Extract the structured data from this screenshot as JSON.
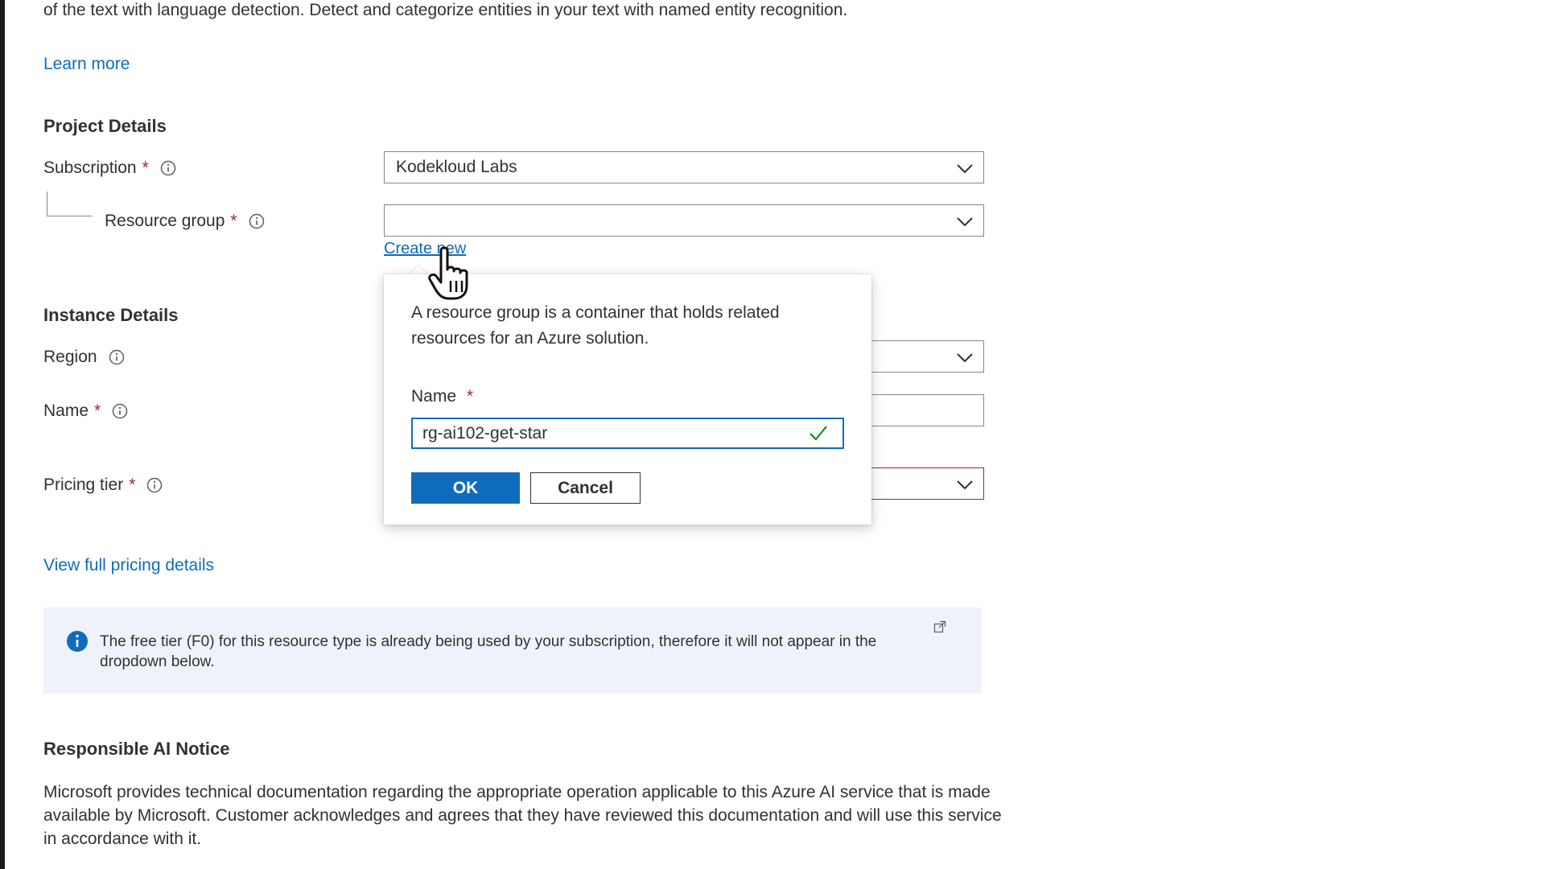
{
  "intro_text": "of the text with language detection. Detect and categorize entities in your text with named entity recognition.",
  "learn_more": "Learn more",
  "project_details": {
    "title": "Project Details",
    "subscription_label": "Subscription",
    "subscription_value": "Kodekloud Labs",
    "resource_group_label": "Resource group",
    "resource_group_value": "",
    "create_new": "Create new",
    "required_mark": "*"
  },
  "instance_details": {
    "title": "Instance Details",
    "region_label": "Region",
    "name_label": "Name",
    "pricing_tier_label": "Pricing tier"
  },
  "view_pricing": "View full pricing details",
  "popup": {
    "description": "A resource group is a container that holds related resources for an Azure solution.",
    "name_label": "Name",
    "name_value": "rg-ai102-get-star",
    "ok_label": "OK",
    "cancel_label": "Cancel"
  },
  "notice": {
    "text": "The free tier (F0) for this resource type is already being used by your subscription, therefore it will not appear in the dropdown below."
  },
  "responsible_ai": {
    "title": "Responsible AI Notice",
    "body": "Microsoft provides technical documentation regarding the appropriate operation applicable to this Azure AI service that is made available by Microsoft. Customer acknowledges and agrees that they have reviewed this documentation and will use this service in accordance with it."
  },
  "colors": {
    "accent": "#0f6cbd",
    "required": "#a4262c",
    "success": "#107c10",
    "notice_bg": "#f0f2fb"
  },
  "icons": [
    "info-icon",
    "chevron-down-icon",
    "checkmark-icon",
    "external-link-icon",
    "hand-pointer-cursor"
  ]
}
